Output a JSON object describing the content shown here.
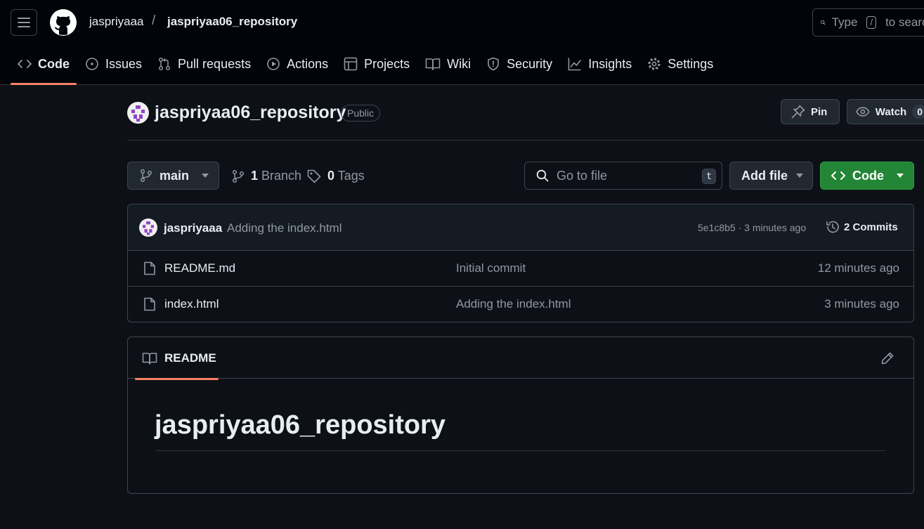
{
  "header": {
    "owner": "jaspriyaaa",
    "separator": "/",
    "repo": "jaspriyaa06_repository",
    "search": {
      "prefix": "Type",
      "key": "/",
      "suffix": "to search"
    }
  },
  "tabs": [
    {
      "label": "Code",
      "icon": "code-icon",
      "active": true
    },
    {
      "label": "Issues",
      "icon": "issue-icon"
    },
    {
      "label": "Pull requests",
      "icon": "pull-request-icon"
    },
    {
      "label": "Actions",
      "icon": "play-icon"
    },
    {
      "label": "Projects",
      "icon": "table-icon"
    },
    {
      "label": "Wiki",
      "icon": "book-icon"
    },
    {
      "label": "Security",
      "icon": "shield-icon"
    },
    {
      "label": "Insights",
      "icon": "graph-icon"
    },
    {
      "label": "Settings",
      "icon": "gear-icon"
    }
  ],
  "repo": {
    "title": "jaspriyaa06_repository",
    "visibility": "Public",
    "pin_label": "Pin",
    "watch_label": "Watch",
    "watch_count": "0"
  },
  "branchbar": {
    "branch": "main",
    "branch_count": "1",
    "branch_label": "Branch",
    "tag_count": "0",
    "tag_label": "Tags",
    "goto_placeholder": "Go to file",
    "goto_key": "t",
    "add_file_label": "Add file",
    "code_label": "Code"
  },
  "latest_commit": {
    "author": "jaspriyaaa",
    "message": "Adding the index.html",
    "hash_time": "5e1c8b5 · 3 minutes ago",
    "commits_label": "2 Commits"
  },
  "files": [
    {
      "name": "README.md",
      "message": "Initial commit",
      "time": "12 minutes ago"
    },
    {
      "name": "index.html",
      "message": "Adding the index.html",
      "time": "3 minutes ago"
    }
  ],
  "readme": {
    "tab_label": "README",
    "heading": "jaspriyaa06_repository"
  },
  "colors": {
    "background": "#0d1117",
    "header_bg": "#010409",
    "accent_underline": "#f78166",
    "primary_button": "#238636",
    "border": "#3d444d",
    "muted_text": "#9198a1"
  }
}
